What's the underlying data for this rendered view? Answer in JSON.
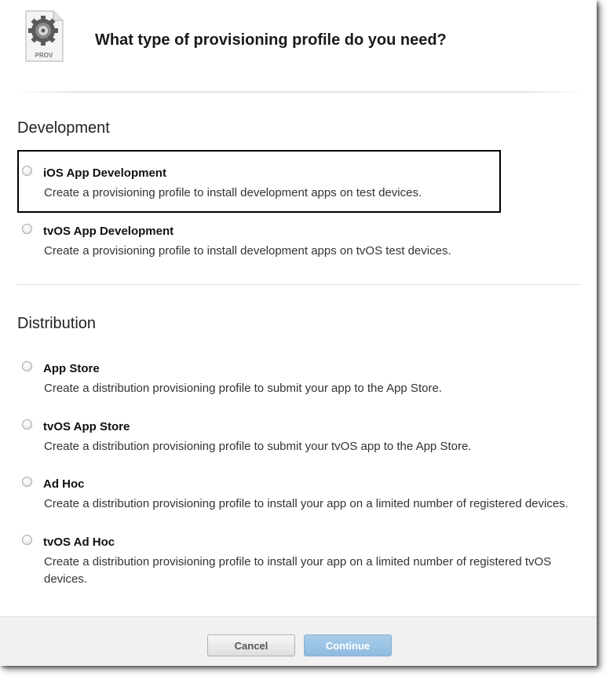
{
  "header": {
    "icon_label": "PROV",
    "title": "What type of provisioning profile do you need?"
  },
  "development": {
    "title": "Development",
    "options": [
      {
        "label": "iOS App Development",
        "description": "Create a provisioning profile to install development apps on test devices."
      },
      {
        "label": "tvOS App Development",
        "description": "Create a provisioning profile to install development apps on tvOS test devices."
      }
    ]
  },
  "distribution": {
    "title": "Distribution",
    "options": [
      {
        "label": "App Store",
        "description": "Create a distribution provisioning profile to submit your app to the App Store."
      },
      {
        "label": "tvOS App Store",
        "description": "Create a distribution provisioning profile to submit your tvOS app to the App Store."
      },
      {
        "label": "Ad Hoc",
        "description": "Create a distribution provisioning profile to install your app on a limited number of registered devices."
      },
      {
        "label": "tvOS Ad Hoc",
        "description": "Create a distribution provisioning profile to install your app on a limited number of registered tvOS devices."
      }
    ]
  },
  "footer": {
    "cancel_label": "Cancel",
    "continue_label": "Continue"
  },
  "colors": {
    "continue_button": "#9fc6e6",
    "highlight_border": "#000000"
  }
}
